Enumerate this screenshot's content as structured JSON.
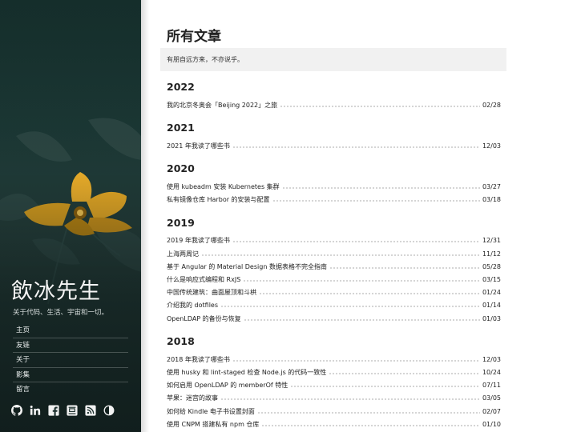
{
  "sidebar": {
    "title": "飲冰先生",
    "subtitle": "关于代码、生活、宇宙和一切。",
    "nav": [
      {
        "label": "主页"
      },
      {
        "label": "友链"
      },
      {
        "label": "关于"
      },
      {
        "label": "影集"
      },
      {
        "label": "留言"
      }
    ],
    "social_icons": [
      "github-icon",
      "linkedin-icon",
      "facebook-icon",
      "douban-icon",
      "rss-icon",
      "theme-toggle-icon"
    ],
    "flower_color": "#e0a423",
    "background_color": "#1b3734"
  },
  "main": {
    "page_title": "所有文章",
    "quote": "有朋自远方来，不亦说乎。",
    "years": [
      {
        "year": "2022",
        "posts": [
          {
            "title": "我的北京冬奥会「Beijing 2022」之旅",
            "date": "02/28"
          }
        ]
      },
      {
        "year": "2021",
        "posts": [
          {
            "title": "2021 年我读了哪些书",
            "date": "12/03"
          }
        ]
      },
      {
        "year": "2020",
        "posts": [
          {
            "title": "使用 kubeadm 安装 Kubernetes 集群",
            "date": "03/27"
          },
          {
            "title": "私有镜像仓库 Harbor 的安装与配置",
            "date": "03/18"
          }
        ]
      },
      {
        "year": "2019",
        "posts": [
          {
            "title": "2019 年我读了哪些书",
            "date": "12/31"
          },
          {
            "title": "上海两周记",
            "date": "11/12"
          },
          {
            "title": "基于 Angular 的 Material Design 数据表格不完全指南",
            "date": "05/28"
          },
          {
            "title": "什么是响应式编程和 RxJS",
            "date": "03/15"
          },
          {
            "title": "中国传统建筑：曲面屋顶和斗栱",
            "date": "01/24"
          },
          {
            "title": "介绍我的 dotfiles",
            "date": "01/14"
          },
          {
            "title": "OpenLDAP 的备份与恢复",
            "date": "01/03"
          }
        ]
      },
      {
        "year": "2018",
        "posts": [
          {
            "title": "2018 年我读了哪些书",
            "date": "12/03"
          },
          {
            "title": "使用 husky 和 lint-staged 检查 Node.js 的代码一致性",
            "date": "10/24"
          },
          {
            "title": "如何启用 OpenLDAP 的 memberOf 特性",
            "date": "07/11"
          },
          {
            "title": "苹果：迷宫的故事",
            "date": "03/05"
          },
          {
            "title": "如何给 Kindle 电子书设置封面",
            "date": "02/07"
          },
          {
            "title": "使用 CNPM 搭建私有 npm 仓库",
            "date": "01/10"
          }
        ]
      }
    ]
  }
}
